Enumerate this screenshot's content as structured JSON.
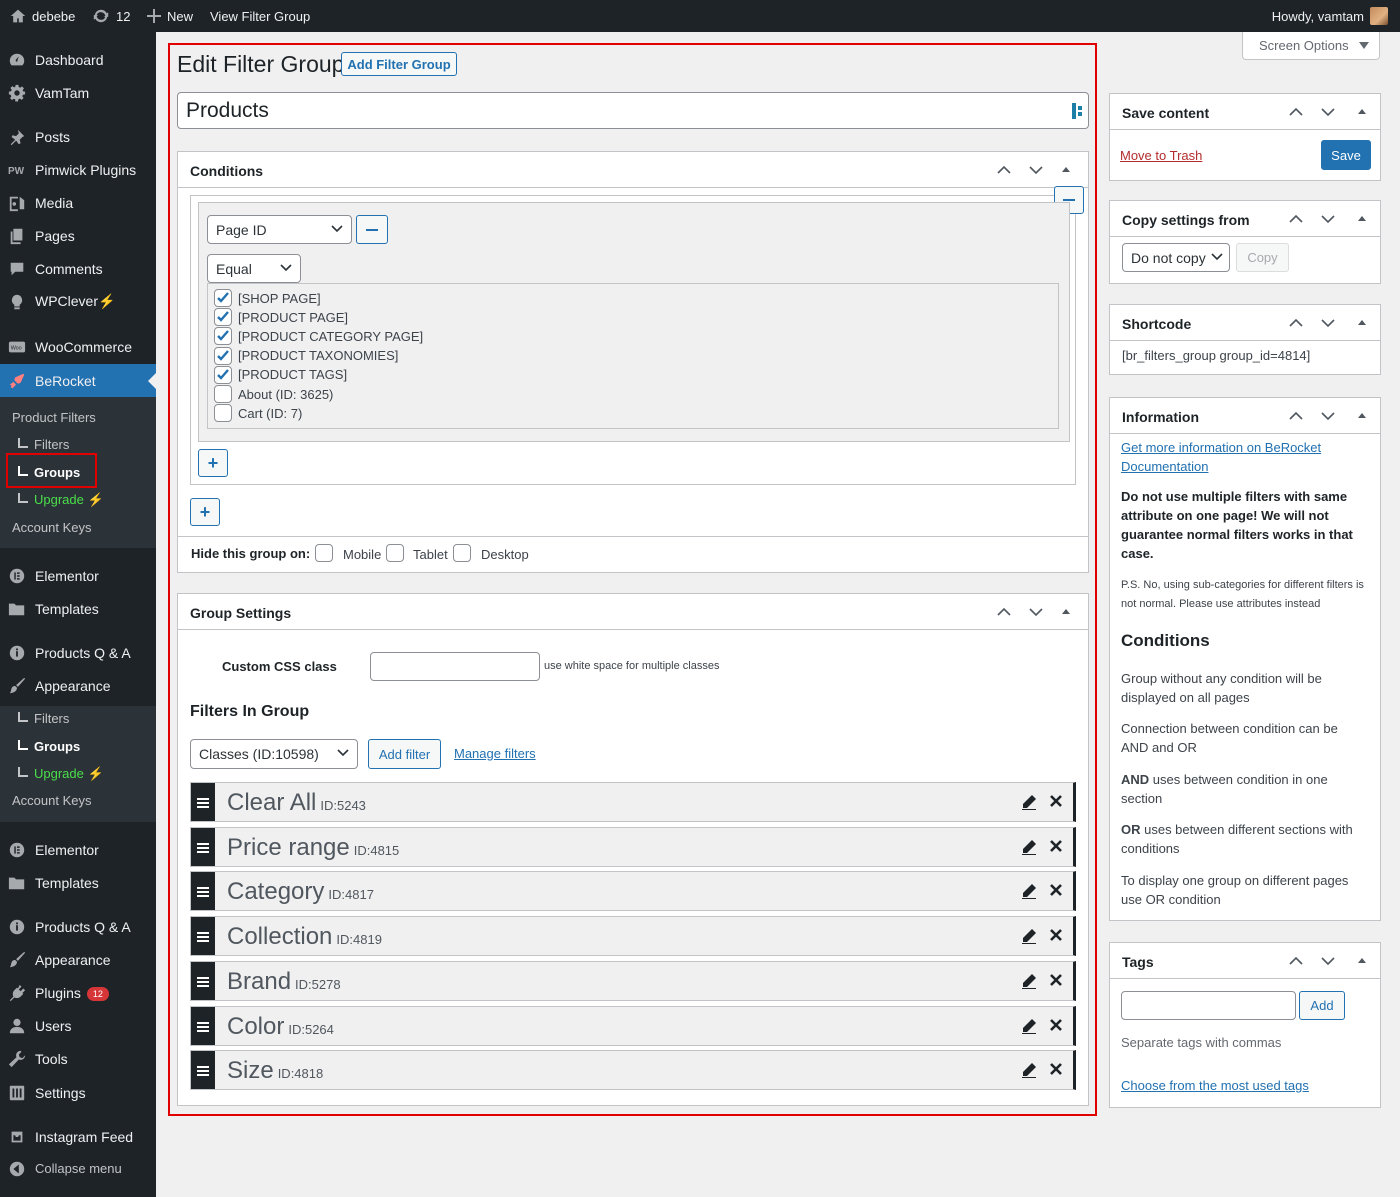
{
  "adminbar": {
    "site_name": "debebe",
    "updates_count": "12",
    "new_label": "New",
    "view_label": "View Filter Group",
    "howdy": "Howdy, vamtam"
  },
  "menu": {
    "dashboard": "Dashboard",
    "vamtam": "VamTam",
    "posts": "Posts",
    "pimwick": "Pimwick Plugins",
    "media": "Media",
    "pages": "Pages",
    "comments": "Comments",
    "wpclever": "WPClever",
    "woocommerce": "WooCommerce",
    "berocket": "BeRocket",
    "sub1": {
      "product_filters": "Product Filters",
      "filters": "Filters",
      "groups": "Groups",
      "upgrade": "Upgrade",
      "account_keys": "Account Keys"
    },
    "elementor": "Elementor",
    "templates": "Templates",
    "products_qa": "Products Q & A",
    "appearance": "Appearance",
    "sub2": {
      "filters": "Filters",
      "groups": "Groups",
      "upgrade": "Upgrade",
      "account_keys": "Account Keys"
    },
    "elementor2": "Elementor",
    "templates2": "Templates",
    "products_qa2": "Products Q & A",
    "appearance2": "Appearance",
    "plugins": "Plugins",
    "plugins_badge": "12",
    "users": "Users",
    "tools": "Tools",
    "settings": "Settings",
    "instagram": "Instagram Feed",
    "collapse": "Collapse menu"
  },
  "screen_options": "Screen Options",
  "page": {
    "heading": "Edit Filter Group",
    "add_button": "Add Filter Group",
    "title_value": "Products"
  },
  "conditions": {
    "title": "Conditions",
    "type_select": "Page ID",
    "equal_select": "Equal",
    "items": [
      {
        "label": "[SHOP PAGE]",
        "checked": true
      },
      {
        "label": "[PRODUCT PAGE]",
        "checked": true
      },
      {
        "label": "[PRODUCT CATEGORY PAGE]",
        "checked": true
      },
      {
        "label": "[PRODUCT TAXONOMIES]",
        "checked": true
      },
      {
        "label": "[PRODUCT TAGS]",
        "checked": true
      },
      {
        "label": "About (ID: 3625)",
        "checked": false
      },
      {
        "label": "Cart (ID: 7)",
        "checked": false
      }
    ],
    "hide_label": "Hide this group on:",
    "mobile": "Mobile",
    "tablet": "Tablet",
    "desktop": "Desktop"
  },
  "group_settings": {
    "title": "Group Settings",
    "css_label": "Custom CSS class",
    "css_value": "",
    "css_hint": "use white space for multiple classes",
    "filters_heading": "Filters In Group",
    "filter_select": "Classes (ID:10598)",
    "add_filter": "Add filter",
    "manage_filters": "Manage filters",
    "filters": [
      {
        "name": "Clear All",
        "id": "ID:5243"
      },
      {
        "name": "Price range",
        "id": "ID:4815"
      },
      {
        "name": "Category",
        "id": "ID:4817"
      },
      {
        "name": "Collection",
        "id": "ID:4819"
      },
      {
        "name": "Brand",
        "id": "ID:5278"
      },
      {
        "name": "Color",
        "id": "ID:5264"
      },
      {
        "name": "Size",
        "id": "ID:4818"
      }
    ]
  },
  "save_box": {
    "title": "Save content",
    "trash": "Move to Trash",
    "save": "Save"
  },
  "copy_box": {
    "title": "Copy settings from",
    "select": "Do not copy",
    "copy": "Copy"
  },
  "shortcode_box": {
    "title": "Shortcode",
    "value": "[br_filters_group group_id=4814]"
  },
  "info_box": {
    "title": "Information",
    "link": "Get more information on BeRocket Documentation",
    "warning": "Do not use multiple filters with same attribute on one page! We will not guarantee normal filters works in that case.",
    "ps": "P.S. No, using sub-categories for different filters is not normal. Please use attributes instead",
    "conditions_heading": "Conditions",
    "p1": "Group without any condition will be displayed on all pages",
    "p2": "Connection between condition can be AND and OR",
    "p3_bold": "AND",
    "p3": " uses between condition in one section",
    "p4_bold": "OR",
    "p4": " uses between different sections with conditions",
    "p5": "To display one group on different pages use OR condition"
  },
  "tags_box": {
    "title": "Tags",
    "input_value": "",
    "add": "Add",
    "hint": "Separate tags with commas",
    "choose": "Choose from the most used tags"
  },
  "colors": {
    "accent": "#2271b1",
    "highlight": "#e00000",
    "menu_bg": "#1d2327",
    "danger": "#b32d2e"
  }
}
